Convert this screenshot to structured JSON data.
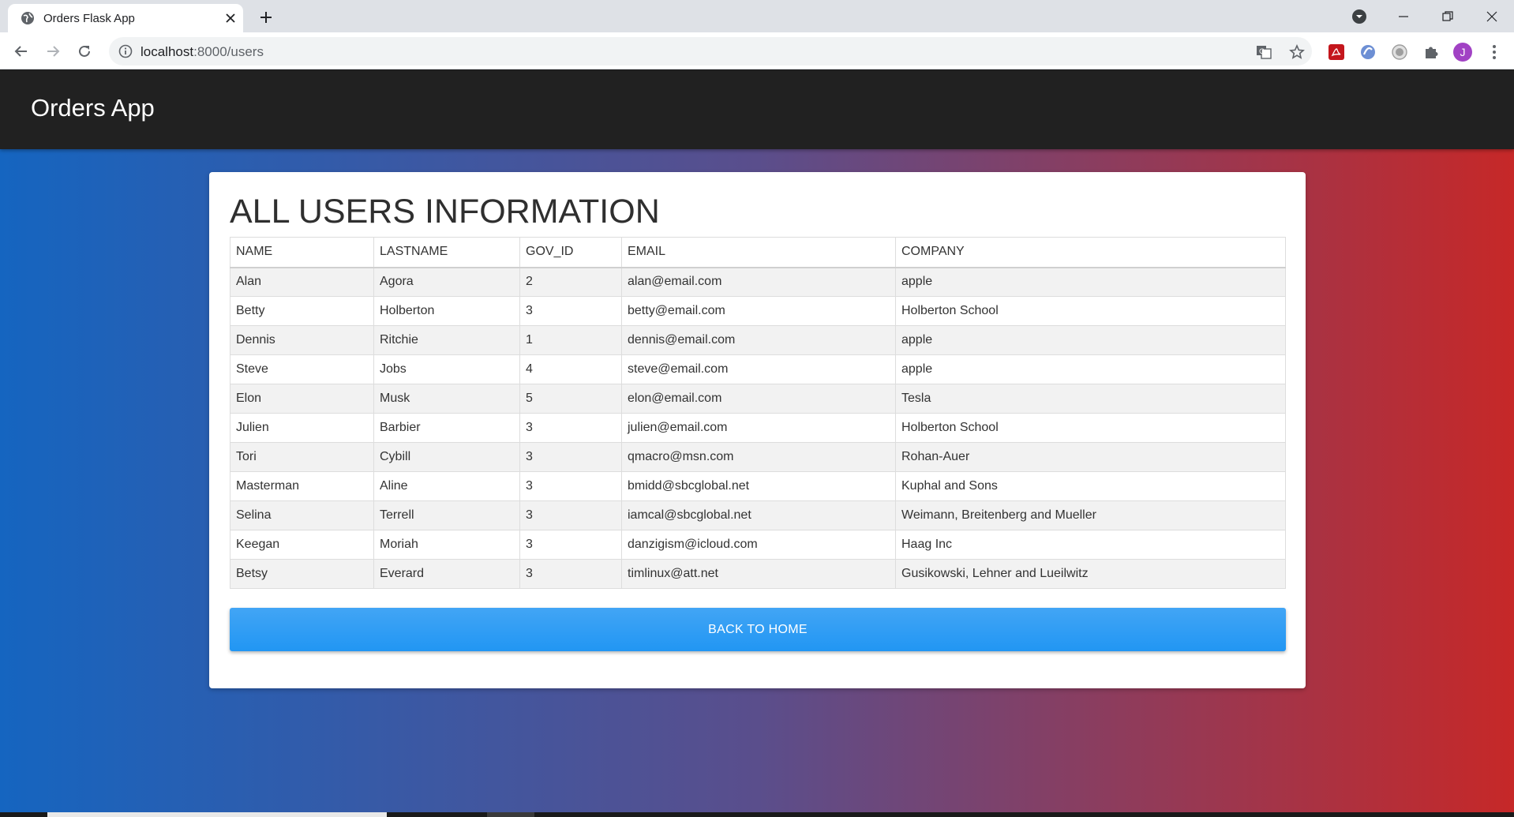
{
  "browser": {
    "tab_title": "Orders Flask App",
    "url_host": "localhost",
    "url_path": ":8000/users",
    "profile_initial": "J"
  },
  "navbar": {
    "brand": "Orders App"
  },
  "card": {
    "title": "ALL USERS INFORMATION",
    "back_button": "BACK TO HOME"
  },
  "table": {
    "headers": [
      "NAME",
      "LASTNAME",
      "GOV_ID",
      "EMAIL",
      "COMPANY"
    ],
    "rows": [
      [
        "Alan",
        "Agora",
        "2",
        "alan@email.com",
        "apple"
      ],
      [
        "Betty",
        "Holberton",
        "3",
        "betty@email.com",
        "Holberton School"
      ],
      [
        "Dennis",
        "Ritchie",
        "1",
        "dennis@email.com",
        "apple"
      ],
      [
        "Steve",
        "Jobs",
        "4",
        "steve@email.com",
        "apple"
      ],
      [
        "Elon",
        "Musk",
        "5",
        "elon@email.com",
        "Tesla"
      ],
      [
        "Julien",
        "Barbier",
        "3",
        "julien@email.com",
        "Holberton School"
      ],
      [
        "Tori",
        "Cybill",
        "3",
        "qmacro@msn.com",
        "Rohan-Auer"
      ],
      [
        "Masterman",
        "Aline",
        "3",
        "bmidd@sbcglobal.net",
        "Kuphal and Sons"
      ],
      [
        "Selina",
        "Terrell",
        "3",
        "iamcal@sbcglobal.net",
        "Weimann, Breitenberg and Mueller"
      ],
      [
        "Keegan",
        "Moriah",
        "3",
        "danzigism@icloud.com",
        "Haag Inc"
      ],
      [
        "Betsy",
        "Everard",
        "3",
        "timlinux@att.net",
        "Gusikowski, Lehner and Lueilwitz"
      ]
    ]
  },
  "colors": {
    "gradient_left": "#1565c0",
    "gradient_right": "#c62828",
    "navbar": "#212121",
    "button": "#2196f3"
  }
}
